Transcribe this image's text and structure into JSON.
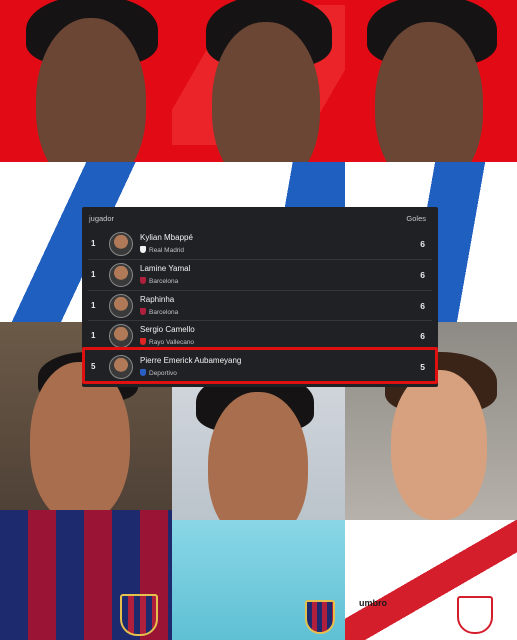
{
  "table": {
    "header_player": "jugador",
    "header_goals": "Goles",
    "rows": [
      {
        "rank": "1",
        "name": "Kylian Mbappé",
        "club": "Real Madrid",
        "goals": "6",
        "club_color": "#f2f2f2"
      },
      {
        "rank": "1",
        "name": "Lamine Yamal",
        "club": "Barcelona",
        "goals": "6",
        "club_color": "#b0203c"
      },
      {
        "rank": "1",
        "name": "Raphinha",
        "club": "Barcelona",
        "goals": "6",
        "club_color": "#b0203c"
      },
      {
        "rank": "1",
        "name": "Sergio Camello",
        "club": "Rayo Vallecano",
        "goals": "6",
        "club_color": "#e02525"
      },
      {
        "rank": "5",
        "name": "Pierre Emerick Aubameyang",
        "club": "Deportivo",
        "goals": "5",
        "club_color": "#2a5fc4"
      }
    ]
  },
  "colors": {
    "background_red": "#e20a14",
    "panel": "#1f2124",
    "highlight": "#e01010"
  },
  "shirt_text": {
    "umbro": "umbro"
  }
}
